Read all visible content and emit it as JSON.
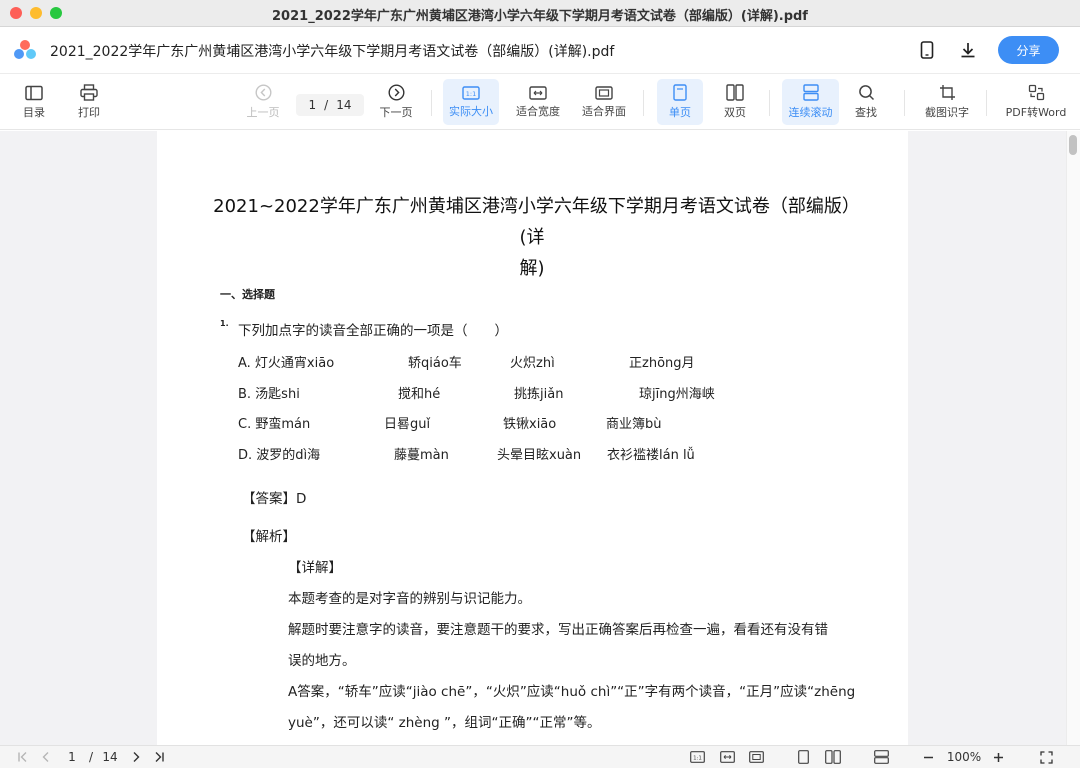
{
  "window": {
    "title": "2021_2022学年广东广州黄埔区港湾小学六年级下学期月考语文试卷（部编版）(详解).pdf"
  },
  "header": {
    "doc_title": "2021_2022学年广东广州黄埔区港湾小学六年级下学期月考语文试卷（部编版）(详解).pdf",
    "share_label": "分享"
  },
  "toolbar": {
    "toc": "目录",
    "print": "打印",
    "prev": "上一页",
    "current_page": "1",
    "page_sep": "/",
    "total_pages": "14",
    "next": "下一页",
    "actual_size": "实际大小",
    "fit_width": "适合宽度",
    "fit_page": "适合界面",
    "single": "单页",
    "double": "双页",
    "continuous": "连续滚动",
    "search": "查找",
    "ocr": "截图识字",
    "to_word": "PDF转Word"
  },
  "document": {
    "heading_line1": "2021~2022学年广东广州黄埔区港湾小学六年级下学期月考语文试卷（部编版）(详",
    "heading_line2": "解)",
    "section": "一、选择题",
    "question_number": "1.",
    "question": "下列加点字的读音全部正确的一项是（　　）",
    "options": {
      "a": [
        "A. 灯火通宵xiāo",
        "轿qiáo车",
        "火炽zhì",
        "正zhōng月"
      ],
      "b": [
        "B. 汤匙shi",
        "搅和hé",
        "挑拣jiǎn",
        "琼jīng州海峡"
      ],
      "c": [
        "C. 野蛮mán",
        "日晷guǐ",
        "铁锹xiāo",
        "商业簿bù"
      ],
      "d": [
        "D. 波罗的dì海",
        "藤蔓màn",
        "头晕目眩xuàn",
        "衣衫褴褛lán lǚ"
      ]
    },
    "answer": "【答案】D",
    "analysis": "【解析】",
    "detail": "【详解】",
    "lines": [
      "本题考查的是对字音的辨别与识记能力。",
      "解题时要注意字的读音，要注意题干的要求，写出正确答案后再检查一遍，看看还有没有错",
      "误的地方。",
      "A答案，“轿车”应读“jiào chē”，“火炽”应读“huǒ chì”“正”字有两个读音，“正月”应读“zhēng",
      "yuè”，还可以读“ zhèng ”，组词“正确”“正常”等。"
    ]
  },
  "bottombar": {
    "current_page": "1",
    "page_sep": "/",
    "total_pages": "14",
    "zoom": "100%"
  },
  "colors": {
    "accent": "#3d8ef5",
    "active_bg": "#e8f1fd",
    "canvas": "#f2f2f4"
  }
}
